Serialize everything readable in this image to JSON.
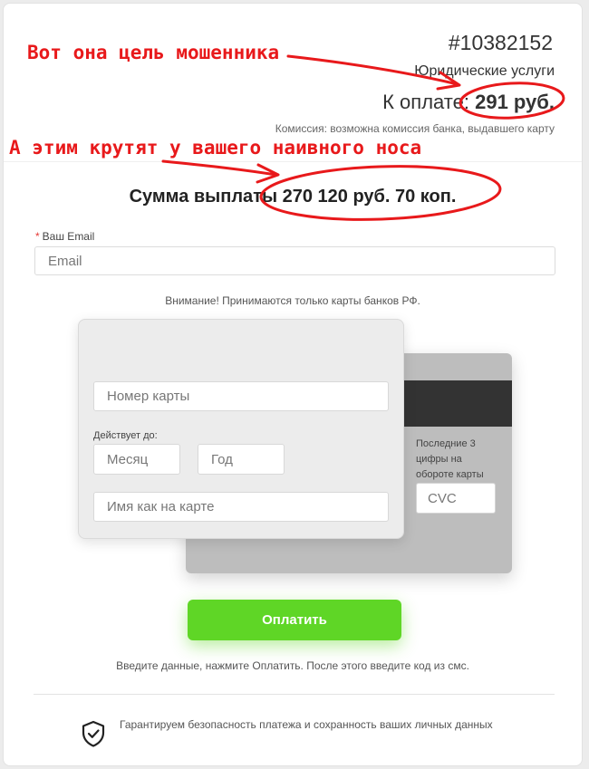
{
  "order": {
    "number": "#10382152",
    "service": "Юридические услуги",
    "to_pay_label": "К оплате:",
    "to_pay_amount": "291 руб.",
    "commission": "Комиссия: возможна комиссия банка, выдавшего карту"
  },
  "payout": {
    "text": "Сумма выплаты 270 120 руб. 70 коп."
  },
  "email": {
    "label": "Ваш Email",
    "required_mark": "*",
    "placeholder": "Email"
  },
  "notice": "Внимание! Принимаются только карты банков РФ.",
  "card": {
    "number_placeholder": "Номер карты",
    "valid_label": "Действует до:",
    "month_placeholder": "Месяц",
    "year_placeholder": "Год",
    "holder_placeholder": "Имя как на карте",
    "cvc_hint": "Последние 3 цифры на обороте карты",
    "cvc_placeholder": "CVC"
  },
  "pay_button": "Оплатить",
  "instructions": "Введите данные, нажмите Оплатить. После этого введите код из смс.",
  "guarantee": "Гарантируем безопасность платежа и сохранность ваших личных данных",
  "annotations": {
    "first": "Вот она цель мошенника",
    "second": "А этим крутят у вашего наивного носа"
  },
  "icons": {
    "security": "shield-check-icon"
  },
  "colors": {
    "accent_green": "#5fd626",
    "annotation_red": "#e8191b",
    "required_red": "#e53935"
  }
}
